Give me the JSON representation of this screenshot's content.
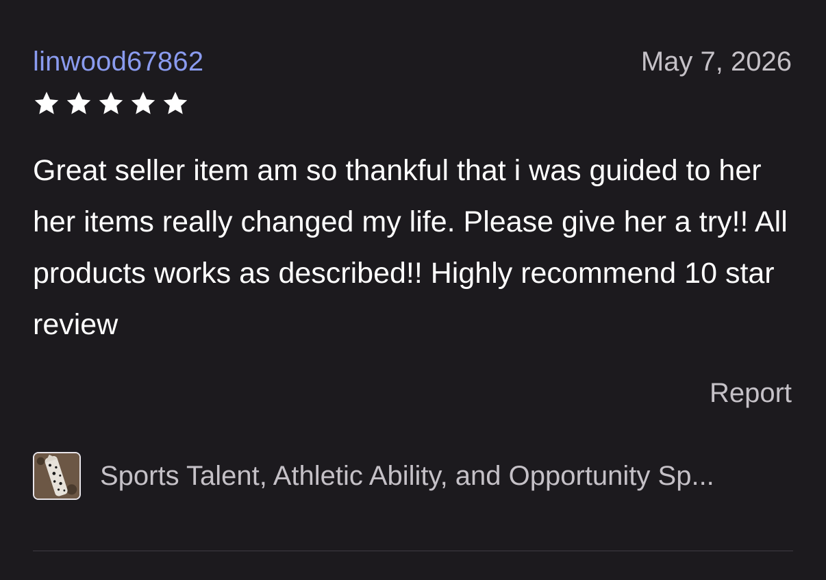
{
  "review": {
    "username": "linwood67862",
    "date": "May 7, 2026",
    "rating": 5,
    "rating_max": 5,
    "text": "Great seller item am so thankful that i was guided to her her items really changed my life. Please give her a try!! All products works as described!! Highly recommend 10 star review",
    "report_label": "Report"
  },
  "item": {
    "title": "Sports Talent, Athletic Ability, and Opportunity Sp...",
    "thumbnail_icon": "dalmatian-jasper-crystal-thumbnail"
  },
  "colors": {
    "background": "#1c1a1e",
    "username": "#8a9bef",
    "muted_text": "#c5c1c7",
    "body_text": "#ffffff",
    "star": "#ffffff",
    "divider": "#3f3c44"
  }
}
